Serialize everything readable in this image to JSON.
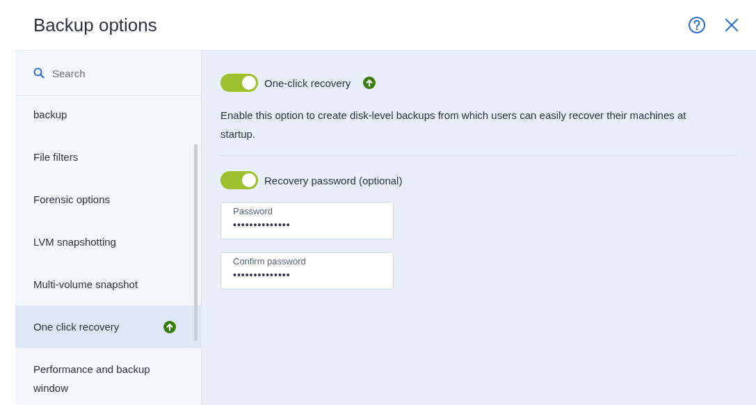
{
  "dialog": {
    "title": "Backup options"
  },
  "sidebar": {
    "search": {
      "placeholder": "Search"
    },
    "items": [
      {
        "label": "backup",
        "selected": false,
        "upgrade_badge": false
      },
      {
        "label": "File filters",
        "selected": false,
        "upgrade_badge": false
      },
      {
        "label": "Forensic options",
        "selected": false,
        "upgrade_badge": false
      },
      {
        "label": "LVM snapshotting",
        "selected": false,
        "upgrade_badge": false
      },
      {
        "label": "Multi-volume snapshot",
        "selected": false,
        "upgrade_badge": false
      },
      {
        "label": "One click recovery",
        "selected": true,
        "upgrade_badge": true
      },
      {
        "label": "Performance and backup window",
        "selected": false,
        "upgrade_badge": false
      }
    ]
  },
  "content": {
    "main_toggle": {
      "label": "One-click recovery",
      "on": true,
      "upgrade_badge": true
    },
    "description": "Enable this option to create disk-level backups from which users can easily recover their machines at startup.",
    "password_toggle": {
      "label": "Recovery password (optional)",
      "on": true
    },
    "fields": [
      {
        "label": "Password",
        "value": "••••••••••••••"
      },
      {
        "label": "Confirm password",
        "value": "••••••••••••••"
      }
    ]
  }
}
